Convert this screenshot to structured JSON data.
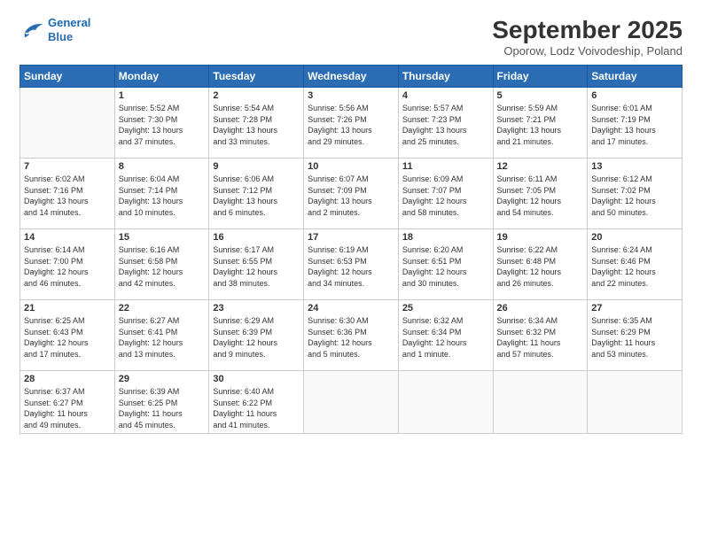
{
  "logo": {
    "line1": "General",
    "line2": "Blue"
  },
  "title": "September 2025",
  "subtitle": "Oporow, Lodz Voivodeship, Poland",
  "days_of_week": [
    "Sunday",
    "Monday",
    "Tuesday",
    "Wednesday",
    "Thursday",
    "Friday",
    "Saturday"
  ],
  "weeks": [
    [
      {
        "day": "",
        "info": ""
      },
      {
        "day": "1",
        "info": "Sunrise: 5:52 AM\nSunset: 7:30 PM\nDaylight: 13 hours\nand 37 minutes."
      },
      {
        "day": "2",
        "info": "Sunrise: 5:54 AM\nSunset: 7:28 PM\nDaylight: 13 hours\nand 33 minutes."
      },
      {
        "day": "3",
        "info": "Sunrise: 5:56 AM\nSunset: 7:26 PM\nDaylight: 13 hours\nand 29 minutes."
      },
      {
        "day": "4",
        "info": "Sunrise: 5:57 AM\nSunset: 7:23 PM\nDaylight: 13 hours\nand 25 minutes."
      },
      {
        "day": "5",
        "info": "Sunrise: 5:59 AM\nSunset: 7:21 PM\nDaylight: 13 hours\nand 21 minutes."
      },
      {
        "day": "6",
        "info": "Sunrise: 6:01 AM\nSunset: 7:19 PM\nDaylight: 13 hours\nand 17 minutes."
      }
    ],
    [
      {
        "day": "7",
        "info": "Sunrise: 6:02 AM\nSunset: 7:16 PM\nDaylight: 13 hours\nand 14 minutes."
      },
      {
        "day": "8",
        "info": "Sunrise: 6:04 AM\nSunset: 7:14 PM\nDaylight: 13 hours\nand 10 minutes."
      },
      {
        "day": "9",
        "info": "Sunrise: 6:06 AM\nSunset: 7:12 PM\nDaylight: 13 hours\nand 6 minutes."
      },
      {
        "day": "10",
        "info": "Sunrise: 6:07 AM\nSunset: 7:09 PM\nDaylight: 13 hours\nand 2 minutes."
      },
      {
        "day": "11",
        "info": "Sunrise: 6:09 AM\nSunset: 7:07 PM\nDaylight: 12 hours\nand 58 minutes."
      },
      {
        "day": "12",
        "info": "Sunrise: 6:11 AM\nSunset: 7:05 PM\nDaylight: 12 hours\nand 54 minutes."
      },
      {
        "day": "13",
        "info": "Sunrise: 6:12 AM\nSunset: 7:02 PM\nDaylight: 12 hours\nand 50 minutes."
      }
    ],
    [
      {
        "day": "14",
        "info": "Sunrise: 6:14 AM\nSunset: 7:00 PM\nDaylight: 12 hours\nand 46 minutes."
      },
      {
        "day": "15",
        "info": "Sunrise: 6:16 AM\nSunset: 6:58 PM\nDaylight: 12 hours\nand 42 minutes."
      },
      {
        "day": "16",
        "info": "Sunrise: 6:17 AM\nSunset: 6:55 PM\nDaylight: 12 hours\nand 38 minutes."
      },
      {
        "day": "17",
        "info": "Sunrise: 6:19 AM\nSunset: 6:53 PM\nDaylight: 12 hours\nand 34 minutes."
      },
      {
        "day": "18",
        "info": "Sunrise: 6:20 AM\nSunset: 6:51 PM\nDaylight: 12 hours\nand 30 minutes."
      },
      {
        "day": "19",
        "info": "Sunrise: 6:22 AM\nSunset: 6:48 PM\nDaylight: 12 hours\nand 26 minutes."
      },
      {
        "day": "20",
        "info": "Sunrise: 6:24 AM\nSunset: 6:46 PM\nDaylight: 12 hours\nand 22 minutes."
      }
    ],
    [
      {
        "day": "21",
        "info": "Sunrise: 6:25 AM\nSunset: 6:43 PM\nDaylight: 12 hours\nand 17 minutes."
      },
      {
        "day": "22",
        "info": "Sunrise: 6:27 AM\nSunset: 6:41 PM\nDaylight: 12 hours\nand 13 minutes."
      },
      {
        "day": "23",
        "info": "Sunrise: 6:29 AM\nSunset: 6:39 PM\nDaylight: 12 hours\nand 9 minutes."
      },
      {
        "day": "24",
        "info": "Sunrise: 6:30 AM\nSunset: 6:36 PM\nDaylight: 12 hours\nand 5 minutes."
      },
      {
        "day": "25",
        "info": "Sunrise: 6:32 AM\nSunset: 6:34 PM\nDaylight: 12 hours\nand 1 minute."
      },
      {
        "day": "26",
        "info": "Sunrise: 6:34 AM\nSunset: 6:32 PM\nDaylight: 11 hours\nand 57 minutes."
      },
      {
        "day": "27",
        "info": "Sunrise: 6:35 AM\nSunset: 6:29 PM\nDaylight: 11 hours\nand 53 minutes."
      }
    ],
    [
      {
        "day": "28",
        "info": "Sunrise: 6:37 AM\nSunset: 6:27 PM\nDaylight: 11 hours\nand 49 minutes."
      },
      {
        "day": "29",
        "info": "Sunrise: 6:39 AM\nSunset: 6:25 PM\nDaylight: 11 hours\nand 45 minutes."
      },
      {
        "day": "30",
        "info": "Sunrise: 6:40 AM\nSunset: 6:22 PM\nDaylight: 11 hours\nand 41 minutes."
      },
      {
        "day": "",
        "info": ""
      },
      {
        "day": "",
        "info": ""
      },
      {
        "day": "",
        "info": ""
      },
      {
        "day": "",
        "info": ""
      }
    ]
  ]
}
